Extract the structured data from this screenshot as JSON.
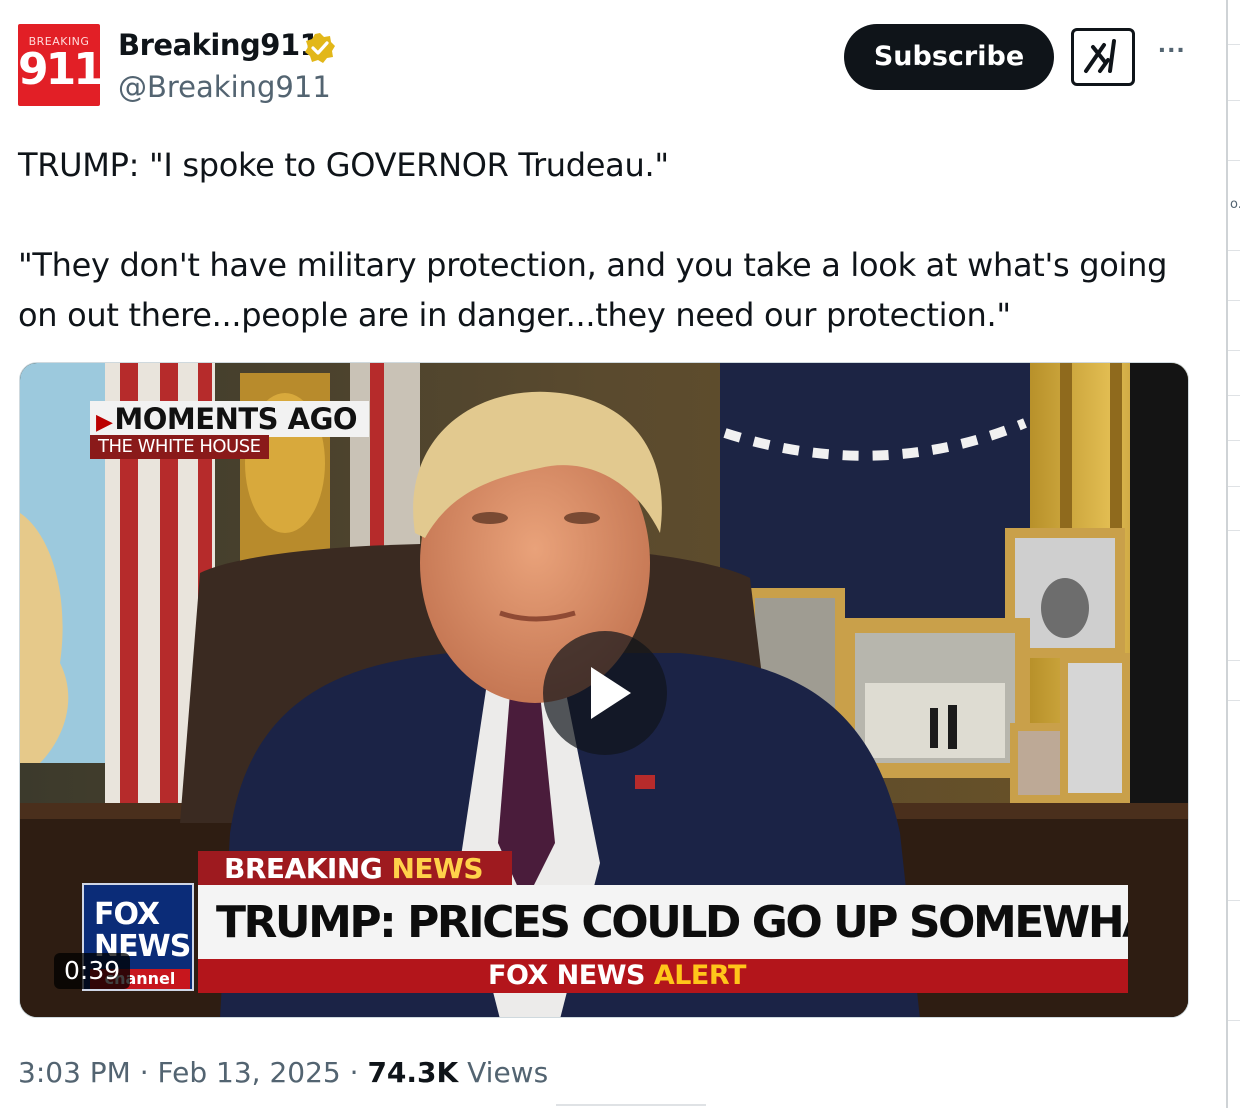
{
  "post": {
    "author": {
      "display_name": "Breaking911",
      "handle": "@Breaking911",
      "verified": true,
      "avatar_small_text": "BREAKING",
      "avatar_big_text": "911",
      "avatar_color": "#e21f26"
    },
    "actions": {
      "subscribe_label": "Subscribe",
      "grok_icon": "grok-icon",
      "more_icon": "more-icon"
    },
    "text": {
      "line1": "TRUMP: \"I spoke to GOVERNOR Trudeau.\"",
      "line2": "\"They don't have military protection, and you take a look at what's going on out there...people are in danger...they need our protection.\""
    },
    "video": {
      "duration": "0:39",
      "overlay": {
        "moments_ago": "MOMENTS AGO",
        "location": "THE WHITE HOUSE",
        "breaking_word1": "BREAKING",
        "breaking_word2": "NEWS",
        "headline": "TRUMP: PRICES COULD GO UP SOMEWHAT SHORT-TERM",
        "alert_word1": "FOX NEWS",
        "alert_word2": "ALERT",
        "logo_line1": "FOX",
        "logo_line2": "NEWS",
        "logo_line3": "channel"
      }
    },
    "meta": {
      "time": "3:03 PM",
      "separator": "·",
      "date": "Feb 13, 2025",
      "views_count": "74.3K",
      "views_label": "Views"
    }
  },
  "right_rail": {
    "fragment": "o."
  },
  "colors": {
    "text_primary": "#0f1419",
    "text_secondary": "#536471",
    "verified_badge": "#e2b719",
    "fox_red": "#b3151b",
    "fox_blue": "#0b2c78"
  }
}
